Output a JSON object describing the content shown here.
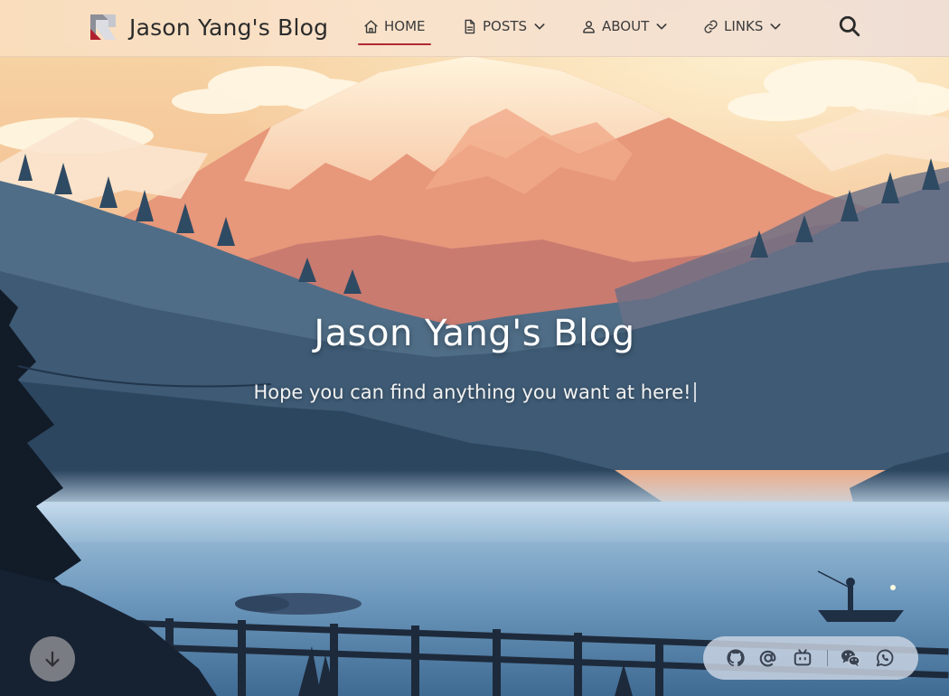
{
  "navbar": {
    "brand_title": "Jason Yang's Blog",
    "items": [
      {
        "label": "HOME",
        "icon": "home-icon",
        "active": true
      },
      {
        "label": "POSTS",
        "icon": "file-icon",
        "dropdown": true
      },
      {
        "label": "ABOUT",
        "icon": "user-icon",
        "dropdown": true
      },
      {
        "label": "LINKS",
        "icon": "link-icon",
        "dropdown": true
      }
    ],
    "search_icon": "search-icon",
    "active_underline_color": "#b02a32"
  },
  "hero": {
    "title": "Jason Yang's Blog",
    "subtitle": "Hope you can find anything you want at here!",
    "scroll_down_icon": "arrow-down-icon"
  },
  "social": {
    "icons": [
      "github-icon",
      "at-email-icon",
      "bilibili-icon",
      "wechat-icon",
      "whatsapp-icon"
    ]
  }
}
